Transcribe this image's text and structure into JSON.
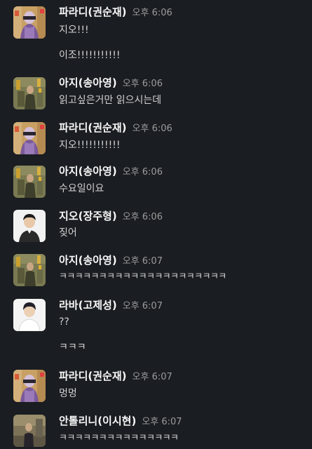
{
  "messages": [
    {
      "sender": "파라디(권순재)",
      "time": "오후 6:06",
      "lines": [
        "지오!!!",
        "이조!!!!!!!!!!!"
      ]
    },
    {
      "sender": "아지(송아영)",
      "time": "오후 6:06",
      "lines": [
        "읽고싶은거만 읽으시는데"
      ]
    },
    {
      "sender": "파라디(권순재)",
      "time": "오후 6:06",
      "lines": [
        "지오!!!!!!!!!!!"
      ]
    },
    {
      "sender": "아지(송아영)",
      "time": "오후 6:06",
      "lines": [
        "수요일이요"
      ]
    },
    {
      "sender": "지오(장주형)",
      "time": "오후 6:06",
      "lines": [
        "짖어"
      ]
    },
    {
      "sender": "아지(송아영)",
      "time": "오후 6:07",
      "lines": [
        "ㅋㅋㅋㅋㅋㅋㅋㅋㅋㅋㅋㅋㅋㅋㅋㅋㅋㅋㅋㅋㅋ"
      ]
    },
    {
      "sender": "라바(고제성)",
      "time": "오후 6:07",
      "lines": [
        "??",
        "ㅋㅋㅋ"
      ]
    },
    {
      "sender": "파라디(권순재)",
      "time": "오후 6:07",
      "lines": [
        "멍멍"
      ]
    },
    {
      "sender": "안톨리니(이시현)",
      "time": "오후 6:07",
      "lines": [
        "ㅋㅋㅋㅋㅋㅋㅋㅋㅋㅋㅋㅋㅋㅋㅋ"
      ]
    }
  ]
}
